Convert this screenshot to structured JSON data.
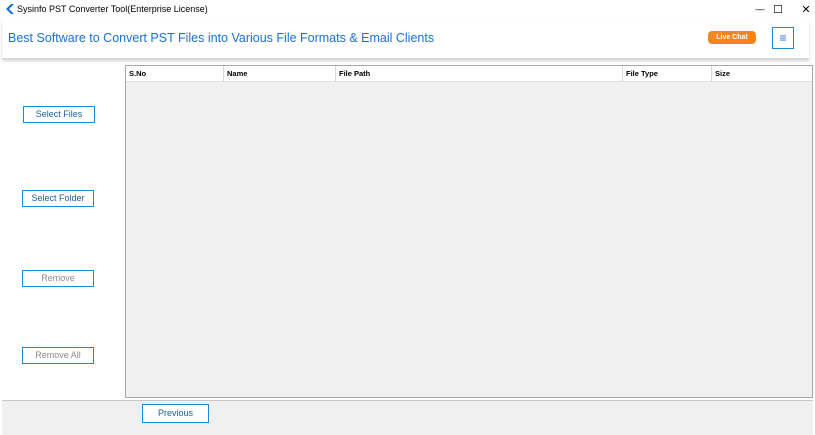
{
  "window": {
    "title": "Sysinfo PST Converter Tool(Enterprise License)",
    "minimize_glyph": "—",
    "maximize_glyph": "☐",
    "close_glyph": "✕"
  },
  "header": {
    "title": "Best Software to Convert PST Files into Various File Formats & Email Clients",
    "live_chat_label": "Live Chat",
    "menu_glyph": "≡"
  },
  "sidebar": {
    "select_files_label": "Select Files",
    "select_folder_label": "Select Folder",
    "remove_label": "Remove",
    "remove_all_label": "Remove All"
  },
  "table": {
    "columns": [
      "S.No",
      "Name",
      "File Path",
      "File Type",
      "Size"
    ],
    "rows": []
  },
  "footer": {
    "previous_label": "Previous"
  },
  "colors": {
    "accent": "#1a8bd6",
    "title_blue": "#1a6fd6",
    "live_chat_orange": "#f5861f"
  }
}
